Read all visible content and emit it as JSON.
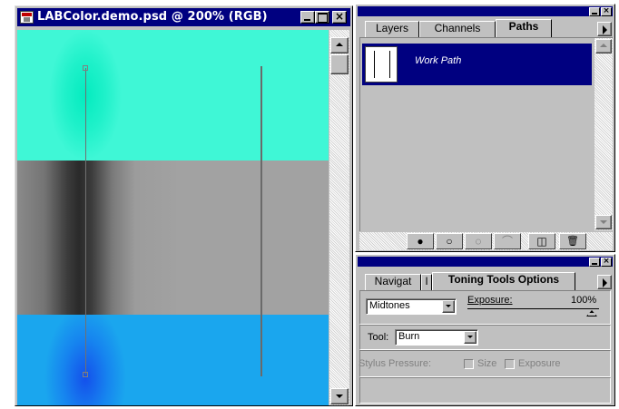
{
  "document": {
    "title": "LABColor.demo.psd @ 200% (RGB)",
    "close_glyph": "×"
  },
  "paths_palette": {
    "tabs": [
      "Layers",
      "Channels",
      "Paths"
    ],
    "active_tab": "Paths",
    "paths": [
      {
        "name": "Work Path"
      }
    ],
    "toolbar_buttons": [
      {
        "name": "fill-path",
        "glyph": "●"
      },
      {
        "name": "stroke-path",
        "glyph": "○"
      },
      {
        "name": "load-as-selection",
        "glyph": "◌"
      },
      {
        "name": "make-work-path",
        "glyph": "⌒"
      },
      {
        "name": "new-path",
        "glyph": "◫"
      },
      {
        "name": "delete-path",
        "glyph": "🗑"
      }
    ],
    "close_glyph": "×"
  },
  "toning_palette": {
    "tabs": [
      "Navigat",
      "I",
      "Toning Tools Options"
    ],
    "active_tab": "Toning Tools Options",
    "range_value": "Midtones",
    "exposure_label": "Exposure:",
    "exposure_value": "100%",
    "tool_label": "Tool:",
    "tool_value": "Burn",
    "stylus_label": "Stylus Pressure:",
    "stylus_size_label": "Size",
    "stylus_exposure_label": "Exposure",
    "stylus_size_checked": false,
    "stylus_exposure_checked": false,
    "close_glyph": "×"
  }
}
